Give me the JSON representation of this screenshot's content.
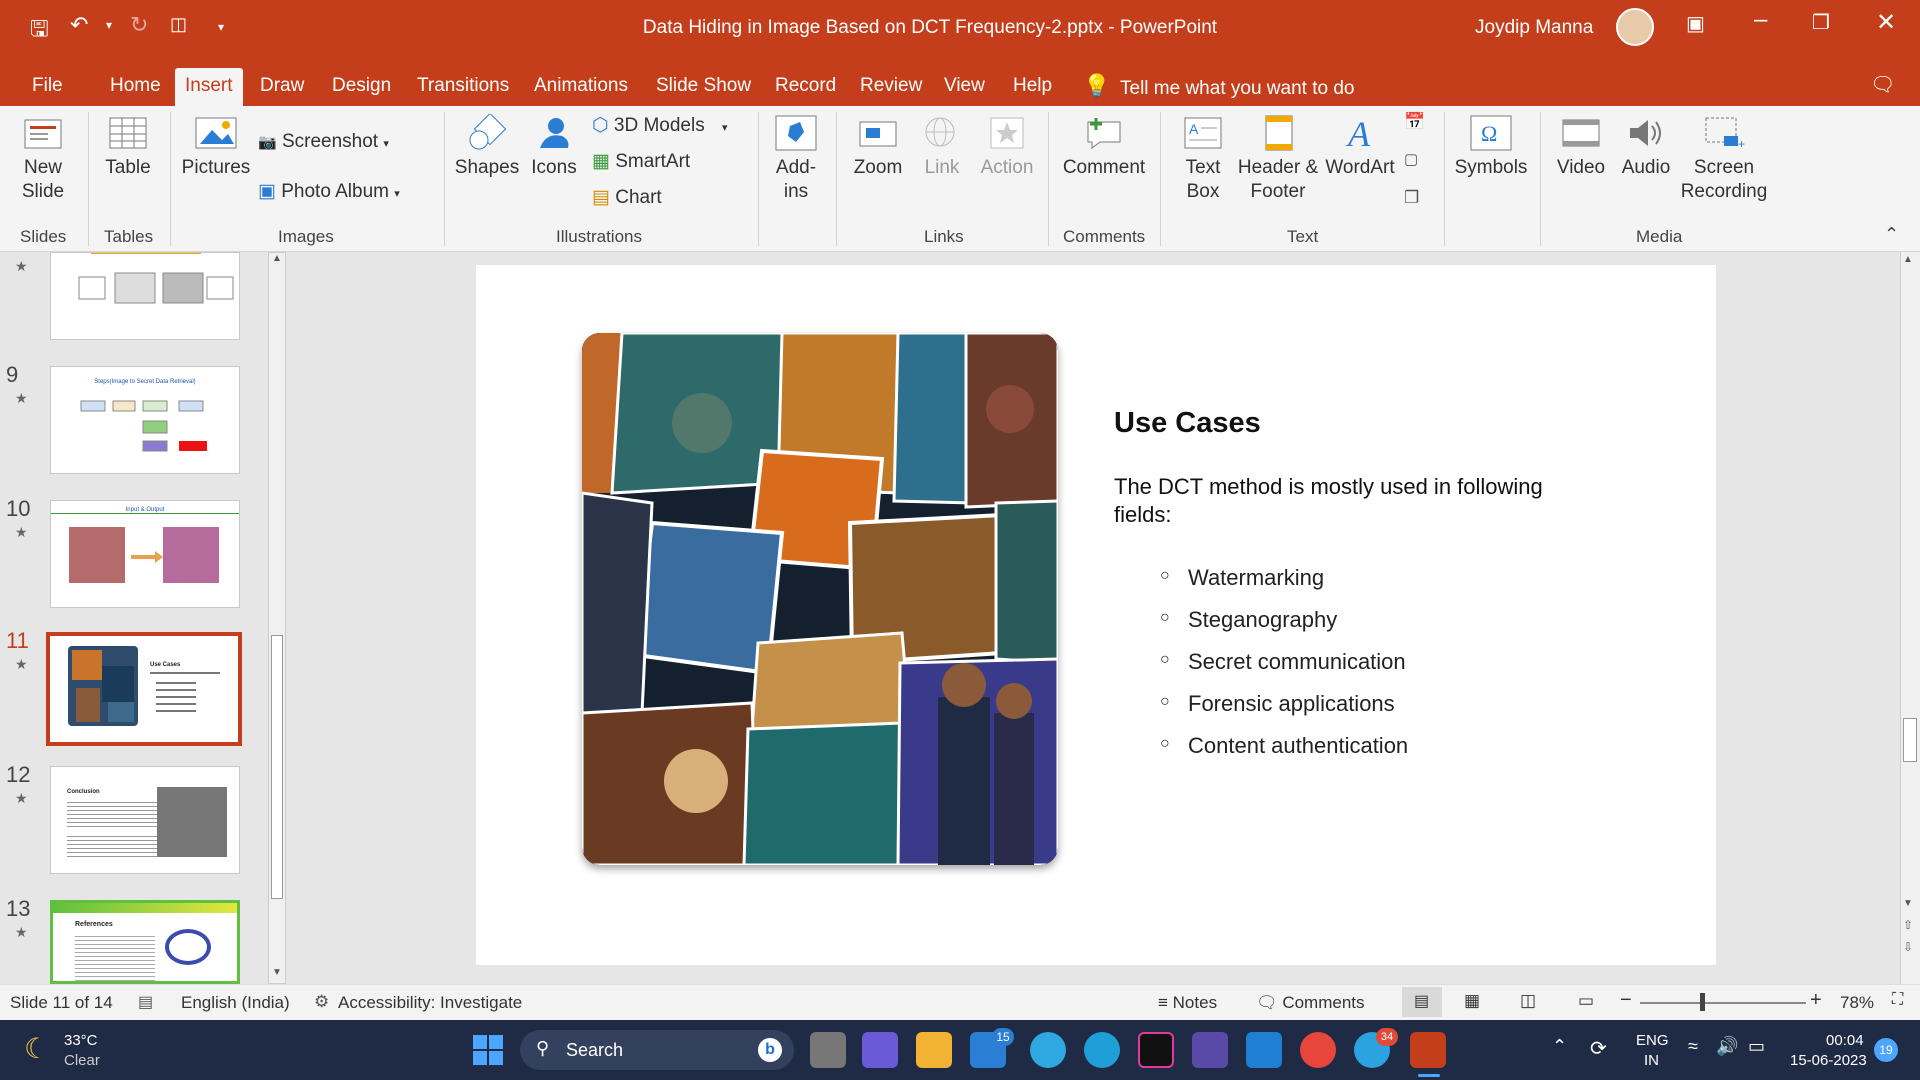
{
  "window": {
    "title": "Data Hiding in Image Based on DCT Frequency-2.pptx  -  PowerPoint",
    "user": "Joydip Manna"
  },
  "tabs": [
    "File",
    "Home",
    "Insert",
    "Draw",
    "Design",
    "Transitions",
    "Animations",
    "Slide Show",
    "Record",
    "Review",
    "View",
    "Help"
  ],
  "active_tab": "Insert",
  "tell_me": "Tell me what you want to do",
  "ribbon": {
    "new_slide": "New Slide",
    "table": "Table",
    "pictures": "Pictures",
    "screenshot": "Screenshot",
    "photo_album": "Photo Album",
    "shapes": "Shapes",
    "icons": "Icons",
    "models3d": "3D Models",
    "smartart": "SmartArt",
    "chart": "Chart",
    "addins": "Add-ins",
    "zoom": "Zoom",
    "link": "Link",
    "action": "Action",
    "comment": "Comment",
    "textbox": "Text Box",
    "header_footer": "Header & Footer",
    "wordart": "WordArt",
    "symbols": "Symbols",
    "video": "Video",
    "audio": "Audio",
    "screen_recording": "Screen Recording",
    "groups": {
      "slides": "Slides",
      "tables": "Tables",
      "images": "Images",
      "illustrations": "Illustrations",
      "links": "Links",
      "comments": "Comments",
      "text": "Text",
      "media": "Media"
    }
  },
  "thumbnails": [
    {
      "num": "9",
      "title": "Steps(Image to Secret Data Retrieval)"
    },
    {
      "num": "10",
      "title": "Input & Output"
    },
    {
      "num": "11",
      "title": "Use Cases"
    },
    {
      "num": "12",
      "title": "Conclusion"
    },
    {
      "num": "13",
      "title": "References"
    }
  ],
  "slide": {
    "heading": "Use Cases",
    "intro": "The DCT method is mostly used in following fields:",
    "bullets": [
      "Watermarking",
      "Steganography",
      "Secret communication",
      "Forensic applications",
      "Content authentication"
    ]
  },
  "status": {
    "slide_info": "Slide 11 of 14",
    "language": "English (India)",
    "accessibility": "Accessibility: Investigate",
    "notes": "Notes",
    "comments": "Comments",
    "zoom": "78%"
  },
  "taskbar": {
    "temp": "33°C",
    "weather": "Clear",
    "search": "Search",
    "lang1": "ENG",
    "lang2": "IN",
    "time": "00:04",
    "date": "15-06-2023",
    "mail_badge": "15",
    "telegram_badge": "34",
    "notif_badge": "19"
  },
  "colors": {
    "accent": "#c43e1c",
    "ribbon_bg": "#f4f4f4",
    "selected_thumb": "#c43e1c",
    "taskbar": "#1f2a44"
  }
}
